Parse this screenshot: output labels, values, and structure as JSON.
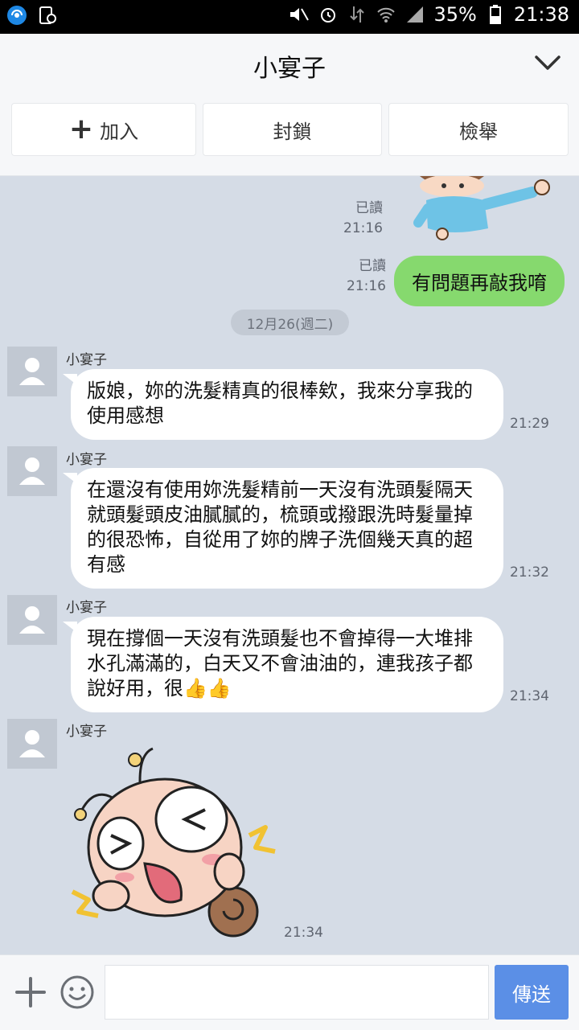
{
  "status_bar": {
    "battery": "35%",
    "time": "21:38"
  },
  "header": {
    "title": "小宴子"
  },
  "actions": [
    {
      "label": "加入",
      "icon": "plus-icon"
    },
    {
      "label": "封鎖"
    },
    {
      "label": "檢舉"
    }
  ],
  "chat": {
    "top_sticker": {
      "read": "已讀",
      "time": "21:16"
    },
    "my_message": {
      "read": "已讀",
      "time": "21:16",
      "text": "有問題再敲我唷"
    },
    "date_separator": "12月26(週二)",
    "messages": [
      {
        "sender": "小宴子",
        "time": "21:29",
        "lines": [
          "版娘，妳的洗髮精真的很棒欸，我來分享我的",
          "使用感想"
        ]
      },
      {
        "sender": "小宴子",
        "time": "21:32",
        "lines": [
          "在還沒有使用妳洗髮精前一天沒有洗頭髮隔天",
          "就頭髮頭皮油膩膩的，梳頭或撥跟洗時髮量掉",
          "的很恐怖，自從用了妳的牌子洗個幾天真的超",
          "有感"
        ]
      },
      {
        "sender": "小宴子",
        "time": "21:34",
        "lines": [
          "現在撐個一天沒有洗頭髮也不會掉得一大堆排",
          "水孔滿滿的，白天又不會油油的，連我孩子都",
          "說好用，很👍👍"
        ]
      },
      {
        "sender": "小宴子",
        "time": "21:34",
        "sticker": "laughing-creature-sticker"
      }
    ]
  },
  "input_bar": {
    "send_label": "傳送"
  },
  "colors": {
    "my_bubble": "#86d96e",
    "send_button": "#5b8fe6",
    "chat_bg": "#d5dce6"
  }
}
